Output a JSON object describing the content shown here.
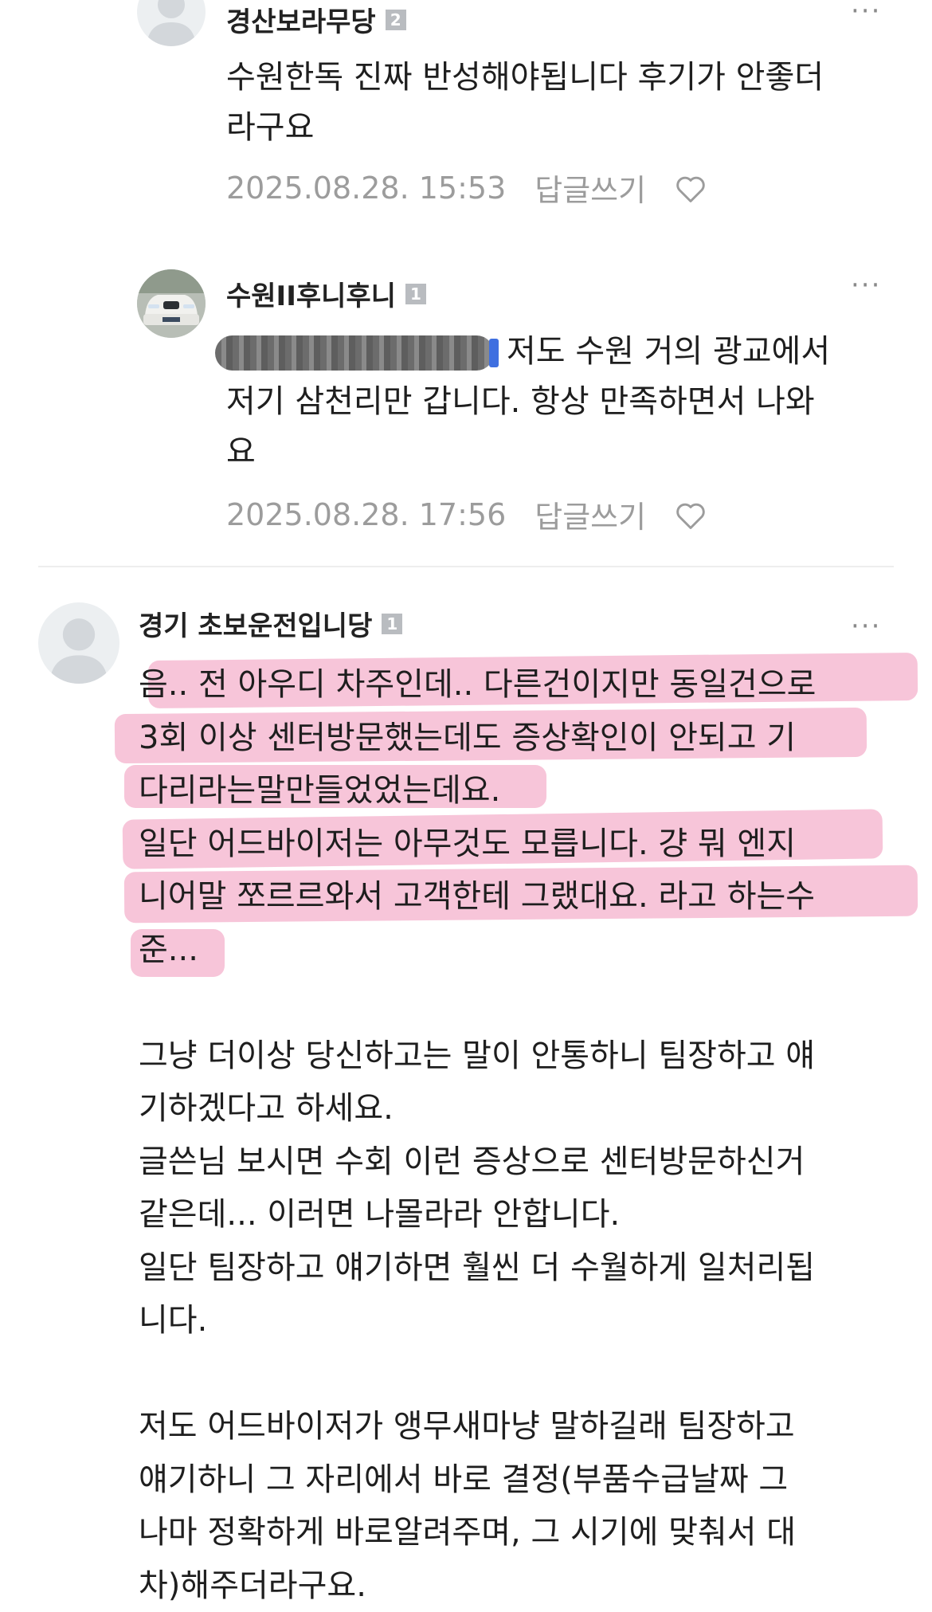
{
  "comments": [
    {
      "nickname": "경산보라무당",
      "level": "2",
      "lines": [
        "수원한독 진짜 반성해야됩니다 후기가 안좋더",
        "라구요"
      ],
      "datetime": "2025.08.28. 15:53",
      "reply_label": "답글쓰기",
      "more": "···"
    },
    {
      "nickname": "수원II후니후니",
      "level": "1",
      "lines": [
        "저도 수원 거의 광교에서",
        "저기 삼천리만 갑니다. 항상 만족하면서 나와",
        "요"
      ],
      "datetime": "2025.08.28. 17:56",
      "reply_label": "답글쓰기",
      "more": "···"
    },
    {
      "nickname": "경기 초보운전입니당",
      "level": "1",
      "more": "···",
      "lines": [
        "음.. 전 아우디 차주인데.. 다른건이지만 동일건으로",
        "3회 이상 센터방문했는데도 증상확인이 안되고 기",
        "다리라는말만들었었는데요.",
        "일단 어드바이저는 아무것도 모릅니다. 걍 뭐 엔지",
        "니어말 쪼르르와서 고객한테 그랬대요. 라고 하는수",
        "준...",
        "",
        "그냥 더이상 당신하고는 말이 안통하니 팀장하고 얘",
        "기하겠다고 하세요.",
        "글쓴님 보시면 수회 이런 증상으로 센터방문하신거",
        "같은데... 이러면 나몰라라 안합니다.",
        "일단 팀장하고 얘기하면 훨씬 더 수월하게 일처리됩",
        "니다.",
        "",
        "저도 어드바이저가 앵무새마냥 말하길래 팀장하고",
        "얘기하니 그 자리에서 바로 결정(부품수급날짜 그",
        "나마 정확하게 바로알려주며, 그 시기에 맞춰서 대",
        "차)해주더라구요."
      ]
    }
  ],
  "colors": {
    "highlight": "#f5b7d0",
    "meta_text": "#9c9c9c",
    "mention_cursor": "#3f6fe0"
  }
}
